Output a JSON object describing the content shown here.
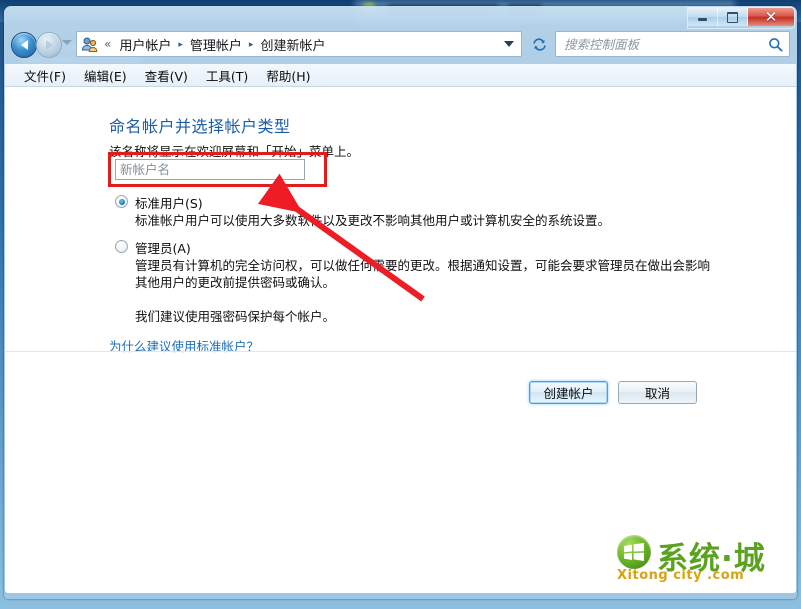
{
  "window": {
    "controls": {
      "minimize_label": "–",
      "maximize_label": "□",
      "close_label": "✕"
    }
  },
  "navbar": {
    "back_tooltip": "后退",
    "forward_tooltip": "前进",
    "breadcrumb": {
      "overflow": "«",
      "items": [
        {
          "label": "用户帐户"
        },
        {
          "label": "管理帐户"
        },
        {
          "label": "创建新帐户"
        }
      ],
      "separator": "▸"
    },
    "refresh_label": "↺",
    "search": {
      "placeholder": "搜索控制面板",
      "value": ""
    }
  },
  "menubar": {
    "items": [
      {
        "label": "文件(F)"
      },
      {
        "label": "编辑(E)"
      },
      {
        "label": "查看(V)"
      },
      {
        "label": "工具(T)"
      },
      {
        "label": "帮助(H)"
      }
    ]
  },
  "main": {
    "title": "命名帐户并选择帐户类型",
    "subtitle": "该名称将显示在欢迎屏幕和「开始」菜单上。",
    "name_input": {
      "placeholder": "新帐户名",
      "value": ""
    },
    "account_types": [
      {
        "label": "标准用户(S)",
        "selected": true,
        "description": "标准帐户用户可以使用大多数软件以及更改不影响其他用户或计算机安全的系统设置。"
      },
      {
        "label": "管理员(A)",
        "selected": false,
        "description": "管理员有计算机的完全访问权，可以做任何需要的更改。根据通知设置，可能会要求管理员在做出会影响其他用户的更改前提供密码或确认。"
      }
    ],
    "recommend_text": "我们建议使用强密码保护每个帐户。",
    "why_link": "为什么建议使用标准帐户？",
    "buttons": {
      "create": "创建帐户",
      "cancel": "取消"
    }
  },
  "annotations": {
    "highlight_color": "#e21b1b",
    "arrow_color": "#ee1c24"
  },
  "watermark": {
    "brand": "系统·城",
    "domain": "Xitong city .com",
    "color": "#5aa21f"
  }
}
